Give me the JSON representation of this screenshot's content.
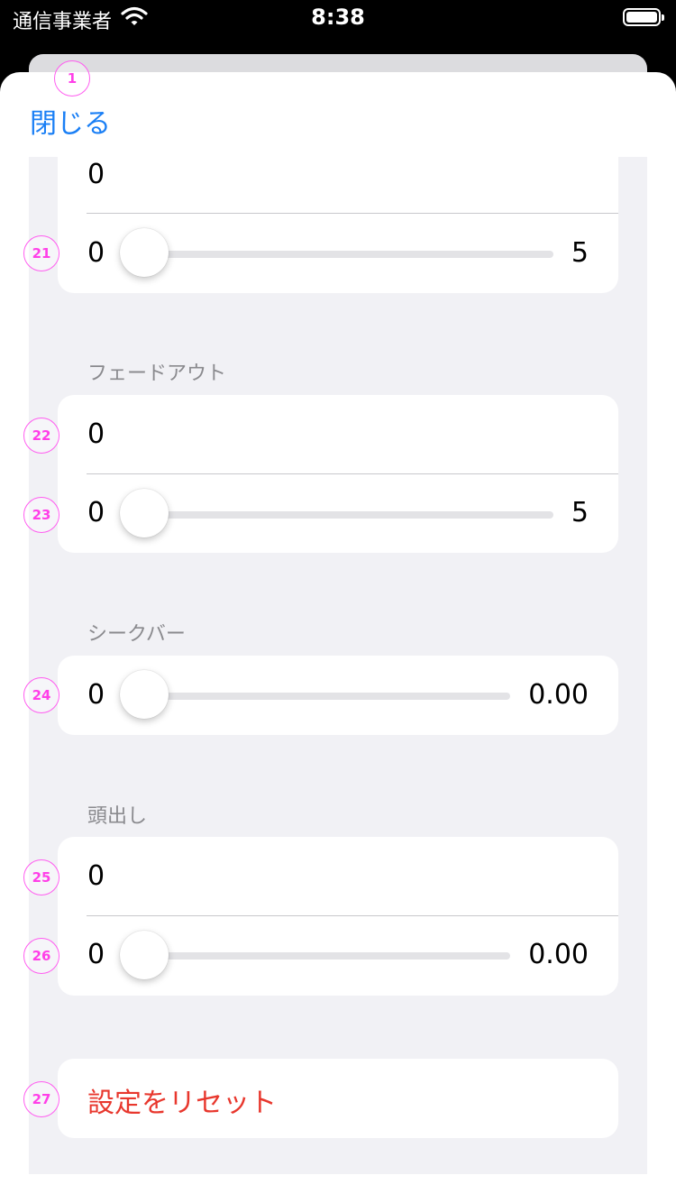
{
  "status_bar": {
    "carrier": "通信事業者",
    "time": "8:38"
  },
  "nav": {
    "close_label": "閉じる"
  },
  "badges": {
    "b1": "1",
    "b21": "21",
    "b22": "22",
    "b23": "23",
    "b24": "24",
    "b25": "25",
    "b26": "26",
    "b27": "27"
  },
  "top_card": {
    "value": "0",
    "slider": {
      "min": "0",
      "max": "5",
      "value": 0
    }
  },
  "fade_out": {
    "header": "フェードアウト",
    "value": "0",
    "slider": {
      "min": "0",
      "max": "5",
      "value": 0
    }
  },
  "seek_bar": {
    "header": "シークバー",
    "slider": {
      "min": "0",
      "max": "0.00",
      "value": 0
    }
  },
  "cue": {
    "header": "頭出し",
    "value": "0",
    "slider": {
      "min": "0",
      "max": "0.00",
      "value": 0
    }
  },
  "reset": {
    "label": "設定をリセット"
  },
  "colors": {
    "accent": "#1a7ff5",
    "destructive": "#e8372d",
    "badge": "#ff3fe8"
  }
}
